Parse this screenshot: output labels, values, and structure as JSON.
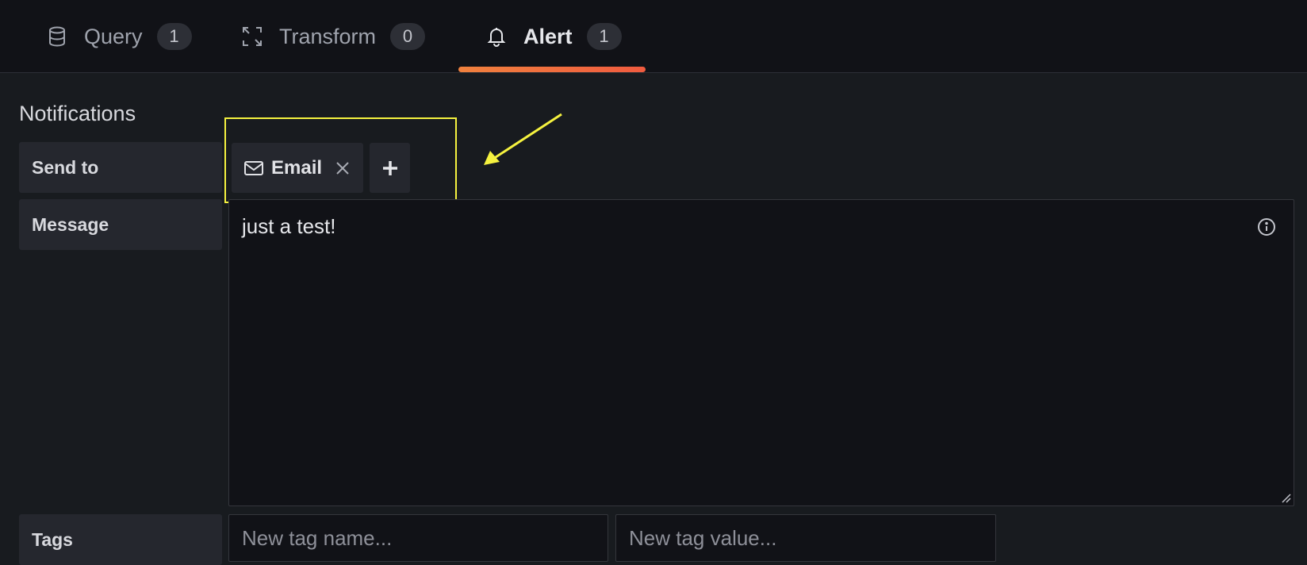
{
  "tabs": [
    {
      "label": "Query",
      "count": "1",
      "icon": "database-icon"
    },
    {
      "label": "Transform",
      "count": "0",
      "icon": "transform-icon"
    },
    {
      "label": "Alert",
      "count": "1",
      "icon": "bell-icon",
      "active": true
    }
  ],
  "notifications": {
    "title": "Notifications",
    "send_to_label": "Send to",
    "channels": [
      {
        "label": "Email",
        "icon": "mail-icon"
      }
    ],
    "message_label": "Message",
    "message_value": "just a test!",
    "tags_label": "Tags",
    "tag_name_placeholder": "New tag name...",
    "tag_value_placeholder": "New tag value..."
  },
  "colors": {
    "active_tab_indicator": "#f05b3f",
    "annotation_highlight": "#f5f23f"
  }
}
